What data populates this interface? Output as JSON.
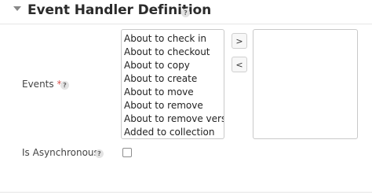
{
  "section": {
    "title": "Event Handler Definition",
    "help_icon": "question-mark-icon",
    "help_glyph": "?",
    "toggle_icon": "caret-down-icon"
  },
  "events_field": {
    "label": "Events",
    "required_marker": "*",
    "help_glyph": "?",
    "options": [
      "About to check in",
      "About to checkout",
      "About to copy",
      "About to create",
      "About to move",
      "About to remove",
      "About to remove versic",
      "Added to collection"
    ],
    "add_button_label": ">",
    "remove_button_label": "<",
    "selected": []
  },
  "async_field": {
    "label": "Is Asynchronous",
    "help_glyph": "?",
    "checked": false
  },
  "colors": {
    "required": "#d9534f",
    "border": "#c9c9c9",
    "text": "#333333"
  }
}
